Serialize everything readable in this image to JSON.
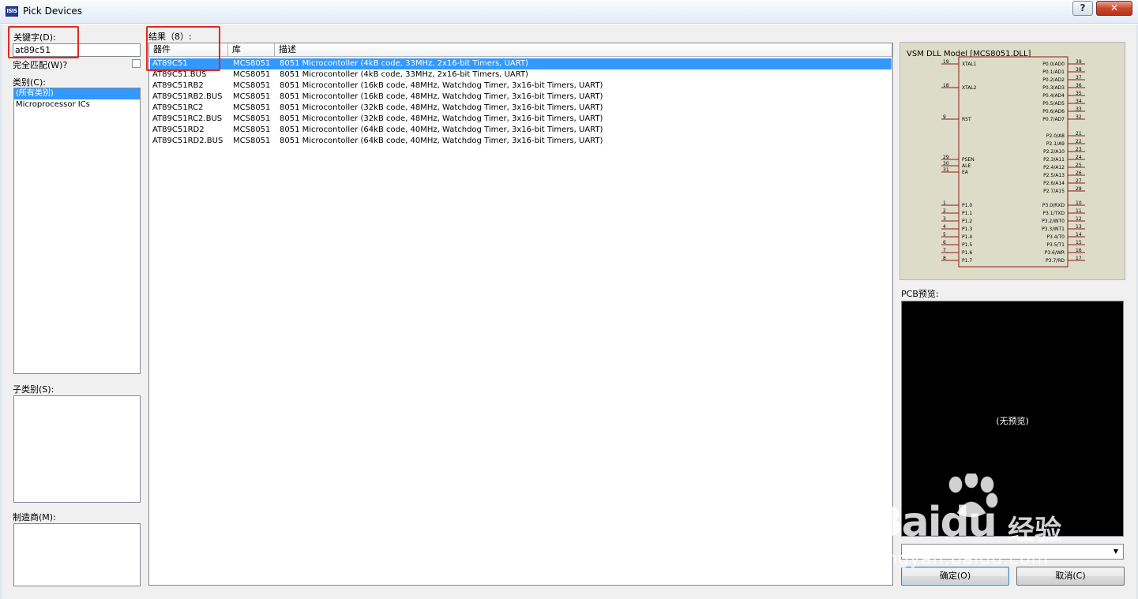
{
  "window": {
    "title": "Pick Devices",
    "icon_text": "ISIS",
    "help_label": "?",
    "close_label": "✕"
  },
  "left": {
    "keyword_label": "关键字(D):",
    "keyword_value": "at89c51",
    "exact_match_label": "完全匹配(W)?",
    "category_label": "类别(C):",
    "categories": [
      "(所有类别)",
      "Microprocessor ICs"
    ],
    "subcategory_label": "子类别(S):",
    "manufacturer_label": "制造商(M):"
  },
  "results": {
    "label": "结果（8）:",
    "columns": [
      "器件",
      "库",
      "描述"
    ],
    "rows": [
      {
        "device": "AT89C51",
        "lib": "MCS8051",
        "desc": "8051 Microcontoller (4kB code, 33MHz, 2x16-bit Timers, UART)"
      },
      {
        "device": "AT89C51.BUS",
        "lib": "MCS8051",
        "desc": "8051 Microcontoller (4kB code, 33MHz, 2x16-bit Timers, UART)"
      },
      {
        "device": "AT89C51RB2",
        "lib": "MCS8051",
        "desc": "8051 Microcontoller (16kB code, 48MHz, Watchdog Timer, 3x16-bit Timers, UART)"
      },
      {
        "device": "AT89C51RB2.BUS",
        "lib": "MCS8051",
        "desc": "8051 Microcontoller (16kB code, 48MHz, Watchdog Timer, 3x16-bit Timers, UART)"
      },
      {
        "device": "AT89C51RC2",
        "lib": "MCS8051",
        "desc": "8051 Microcontoller (32kB code, 48MHz, Watchdog Timer, 3x16-bit Timers, UART)"
      },
      {
        "device": "AT89C51RC2.BUS",
        "lib": "MCS8051",
        "desc": "8051 Microcontoller (32kB code, 48MHz, Watchdog Timer, 3x16-bit Timers, UART)"
      },
      {
        "device": "AT89C51RD2",
        "lib": "MCS8051",
        "desc": "8051 Microcontoller (64kB code, 40MHz, Watchdog Timer, 3x16-bit Timers, UART)"
      },
      {
        "device": "AT89C51RD2.BUS",
        "lib": "MCS8051",
        "desc": "8051 Microcontoller (64kB code, 40MHz, Watchdog Timer, 3x16-bit Timers, UART)"
      }
    ]
  },
  "preview": {
    "model_label": "VSM DLL Model [MCS8051.DLL]",
    "left_pins": [
      {
        "num": "19",
        "name": "XTAL1"
      },
      {
        "num": "18",
        "name": "XTAL2"
      },
      {
        "num": "9",
        "name": "RST"
      },
      {
        "num": "29",
        "name": "PSEN"
      },
      {
        "num": "30",
        "name": "ALE"
      },
      {
        "num": "31",
        "name": "EA"
      },
      {
        "num": "1",
        "name": "P1.0"
      },
      {
        "num": "2",
        "name": "P1.1"
      },
      {
        "num": "3",
        "name": "P1.2"
      },
      {
        "num": "4",
        "name": "P1.3"
      },
      {
        "num": "5",
        "name": "P1.4"
      },
      {
        "num": "6",
        "name": "P1.5"
      },
      {
        "num": "7",
        "name": "P1.6"
      },
      {
        "num": "8",
        "name": "P1.7"
      }
    ],
    "right_pins": [
      {
        "num": "39",
        "name": "P0.0/AD0"
      },
      {
        "num": "38",
        "name": "P0.1/AD1"
      },
      {
        "num": "37",
        "name": "P0.2/AD2"
      },
      {
        "num": "36",
        "name": "P0.3/AD3"
      },
      {
        "num": "35",
        "name": "P0.4/AD4"
      },
      {
        "num": "34",
        "name": "P0.5/AD5"
      },
      {
        "num": "33",
        "name": "P0.6/AD6"
      },
      {
        "num": "32",
        "name": "P0.7/AD7"
      },
      {
        "num": "21",
        "name": "P2.0/A8"
      },
      {
        "num": "22",
        "name": "P2.1/A9"
      },
      {
        "num": "23",
        "name": "P2.2/A10"
      },
      {
        "num": "24",
        "name": "P2.3/A11"
      },
      {
        "num": "25",
        "name": "P2.4/A12"
      },
      {
        "num": "26",
        "name": "P2.5/A13"
      },
      {
        "num": "27",
        "name": "P2.6/A14"
      },
      {
        "num": "28",
        "name": "P2.7/A15"
      },
      {
        "num": "10",
        "name": "P3.0/RXD"
      },
      {
        "num": "11",
        "name": "P3.1/TXD"
      },
      {
        "num": "12",
        "name": "P3.2/INT0"
      },
      {
        "num": "13",
        "name": "P3.3/INT1"
      },
      {
        "num": "14",
        "name": "P3.4/T0"
      },
      {
        "num": "15",
        "name": "P3.5/T1"
      },
      {
        "num": "16",
        "name": "P3.6/WR"
      },
      {
        "num": "17",
        "name": "P3.7/RD"
      }
    ],
    "pcb_label": "PCB预览:",
    "pcb_empty": "(无预览)"
  },
  "buttons": {
    "ok": "确定(O)",
    "cancel": "取消(C)"
  },
  "watermark": {
    "brand": "Baidu",
    "cn": "经验",
    "url": "jingyan.baidu.com"
  },
  "colors": {
    "selection": "#3399ff",
    "highlight_box": "#e8261c",
    "schematic_bg": "#dddcc8",
    "schematic_line": "#8b1a1a",
    "pcb_bg": "#000000"
  }
}
